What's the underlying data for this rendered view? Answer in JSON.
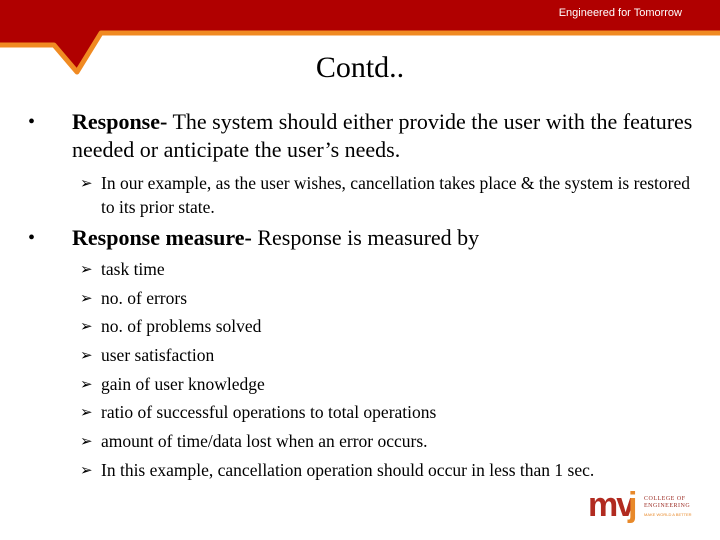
{
  "header": {
    "tagline": "Engineered for Tomorrow",
    "colors": {
      "banner": "#b00000",
      "accent": "#f08a22"
    }
  },
  "slide": {
    "title": "Contd..",
    "bullets": [
      {
        "bold": "Response-",
        "text": " The system should either provide the user with the features needed or anticipate the user’s needs.",
        "subitems": [
          "In our example, as the user wishes, cancellation takes place & the system is restored to its prior state."
        ]
      },
      {
        "bold": "Response measure-",
        "text": " Response is measured by",
        "subitems": [
          "task time",
          "no. of errors",
          "no. of problems solved",
          "user satisfaction",
          "gain of user knowledge",
          "ratio of successful operations to total operations",
          "amount of time/data lost when an error occurs.",
          "In this example, cancellation operation should occur in less than 1 sec."
        ]
      }
    ],
    "bullet_glyph": "•",
    "sub_bullet_glyph": "➢"
  },
  "logo": {
    "mark_mv": "mv",
    "mark_j": "j",
    "line1": "COLLEGE OF",
    "line2": "ENGINEERING",
    "line3": "MAKE WORLD A BETTER"
  }
}
